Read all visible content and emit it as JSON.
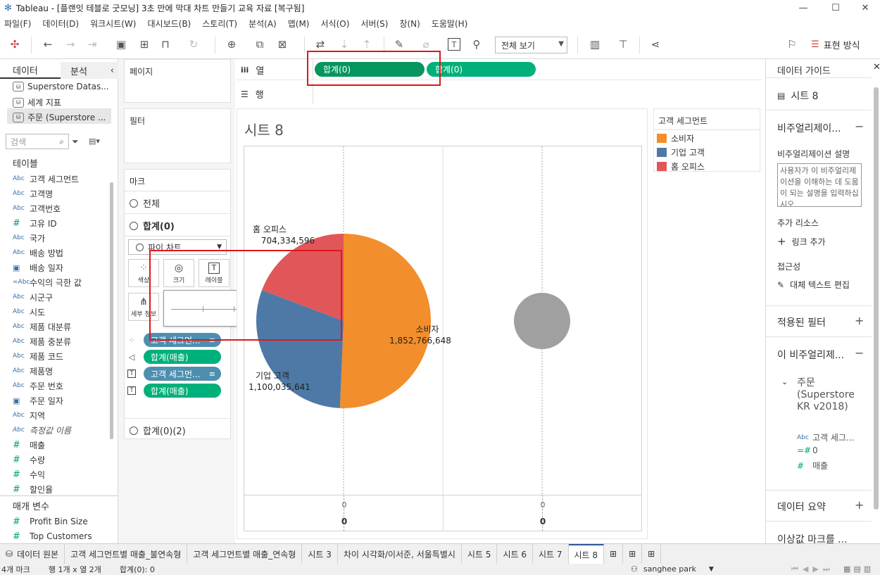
{
  "window": {
    "title": "Tableau - [플랜잇 테블로 굿모닝] 3초 만에 막대 차트 만들기 교육 자료 [복구됨]",
    "minimize_icon": "minimize-icon",
    "maximize_icon": "maximize-icon",
    "close_icon": "close-icon"
  },
  "menu": [
    "파일(F)",
    "데이터(D)",
    "워크시트(W)",
    "대시보드(B)",
    "스토리(T)",
    "분석(A)",
    "맵(M)",
    "서식(O)",
    "서버(S)",
    "창(N)",
    "도움말(H)"
  ],
  "toolbar": {
    "view_select": "전체 보기",
    "show_me": "표현 방식"
  },
  "left_pane": {
    "tab_data": "데이터",
    "tab_analysis": "분석",
    "datasources": [
      "Superstore Datas...",
      "세계 지표",
      "주문 (Superstore ..."
    ],
    "search_placeholder": "검색",
    "tables_heading": "테이블",
    "fields": [
      {
        "type": "Abc",
        "name": "고객 세그먼트"
      },
      {
        "type": "Abc",
        "name": "고객명"
      },
      {
        "type": "Abc",
        "name": "고객번호"
      },
      {
        "type": "#",
        "name": "고유 ID"
      },
      {
        "type": "Abc",
        "name": "국가"
      },
      {
        "type": "Abc",
        "name": "배송 방법"
      },
      {
        "type": "date",
        "name": "배송 일자"
      },
      {
        "type": "=Abc",
        "name": "수익의 극한 값"
      },
      {
        "type": "Abc",
        "name": "시군구"
      },
      {
        "type": "Abc",
        "name": "시도"
      },
      {
        "type": "Abc",
        "name": "제품 대분류"
      },
      {
        "type": "Abc",
        "name": "제품 중분류"
      },
      {
        "type": "Abc",
        "name": "제품 코드"
      },
      {
        "type": "Abc",
        "name": "제품명"
      },
      {
        "type": "Abc",
        "name": "주문 번호"
      },
      {
        "type": "date",
        "name": "주문 일자"
      },
      {
        "type": "Abc",
        "name": "지역"
      },
      {
        "type": "Abc",
        "name": "측정값 이름"
      },
      {
        "type": "#",
        "name": "매출"
      },
      {
        "type": "#",
        "name": "수량"
      },
      {
        "type": "#",
        "name": "수익"
      },
      {
        "type": "#",
        "name": "할인율"
      }
    ],
    "params_heading": "매개 변수",
    "params": [
      "Profit Bin Size",
      "Top Customers"
    ]
  },
  "cards": {
    "pages": "페이지",
    "filters": "필터",
    "marks": "마크",
    "marks_all": "전체",
    "marks_sum0": "합계(0)",
    "mark_type": "파이 차트",
    "btn_color": "색상",
    "btn_size": "크기",
    "btn_label": "레이블",
    "btn_detail": "세부 정보",
    "pills": [
      "고객 세그먼...",
      "합계(매출)",
      "고객 세그먼...",
      "합계(매출)"
    ],
    "marks_sum02": "합계(0)(2)",
    "size_slider_level": 0.62
  },
  "shelves": {
    "columns_label": "열",
    "rows_label": "행",
    "column_pills": [
      "합계(0)",
      "합계(0)"
    ]
  },
  "sheet": {
    "title": "시트 8"
  },
  "chart_data": {
    "type": "pie",
    "categories": [
      "소비자",
      "기업 고객",
      "홈 오피스"
    ],
    "values": [
      1852766648,
      1100035641,
      704334596
    ],
    "value_labels": [
      "1,852,766,648",
      "1,100,035,641",
      "704,334,596"
    ],
    "colors": [
      "#f28e2b",
      "#4e79a7",
      "#e15759"
    ],
    "second_pie_color": "#a0a0a0",
    "axis_ticks": [
      "0",
      "0"
    ],
    "axis_values": [
      "0",
      "0"
    ],
    "legend_title": "고객 세그먼트",
    "legend_placement": "top-right"
  },
  "guide": {
    "title": "데이터 가이드",
    "sheet": "시트 8",
    "viz_section": "비주얼리제이...",
    "desc_label": "비주얼리제이션 설명",
    "desc_placeholder": "사용자가 이 비주얼리제이션을 이해하는 데 도움이 되는 설명을 입력하십시오.",
    "resources": "추가 리소스",
    "add_link": "링크 추가",
    "accessibility": "접근성",
    "alt_text": "대체 텍스트 편집",
    "applied_filters": "적용된 필터",
    "this_viz": "이 비주얼리제...",
    "source": "주문 (Superstore KR v2018)",
    "src_fields": [
      {
        "type": "Abc",
        "name": "고객 세그..."
      },
      {
        "type": "=#",
        "name": "0"
      },
      {
        "type": "#",
        "name": "매출"
      }
    ],
    "data_summary": "데이터 요약",
    "outliers": "이상값 마크를 ..."
  },
  "bottom_tabs": [
    "데이터 원본",
    "고객 세그먼트별 매출_불연속형",
    "고객 세그먼트별 매출_연속형",
    "시트 3",
    "차이 시각화/이서준, 서울특별시",
    "시트 5",
    "시트 6",
    "시트 7",
    "시트 8"
  ],
  "status": {
    "marks": "4개 마크",
    "rows_cols": "행 1개 x 열 2개",
    "sum": "합계(0): 0",
    "user": "sanghee park"
  }
}
